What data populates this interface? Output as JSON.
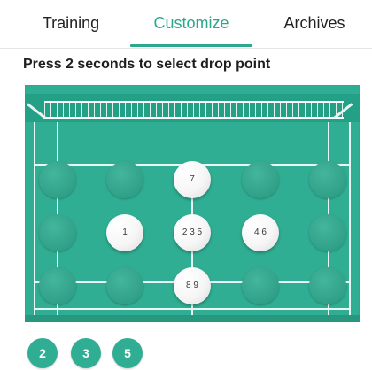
{
  "tabs": [
    {
      "label": "Training",
      "active": false
    },
    {
      "label": "Customize",
      "active": true
    },
    {
      "label": "Archives",
      "active": false
    }
  ],
  "instruction": "Press 2 seconds to select drop point",
  "court": {
    "colors": {
      "court": "#2fae93",
      "accent": "#2ca88f",
      "selected": "#ffffff"
    },
    "drop_points": [
      {
        "row": 1,
        "col": 1,
        "selected": false,
        "labels": ""
      },
      {
        "row": 1,
        "col": 2,
        "selected": false,
        "labels": ""
      },
      {
        "row": 1,
        "col": 3,
        "selected": true,
        "labels": "7"
      },
      {
        "row": 1,
        "col": 4,
        "selected": false,
        "labels": ""
      },
      {
        "row": 1,
        "col": 5,
        "selected": false,
        "labels": ""
      },
      {
        "row": 2,
        "col": 1,
        "selected": false,
        "labels": ""
      },
      {
        "row": 2,
        "col": 2,
        "selected": true,
        "labels": "1"
      },
      {
        "row": 2,
        "col": 3,
        "selected": true,
        "labels": "2 3 5"
      },
      {
        "row": 2,
        "col": 4,
        "selected": true,
        "labels": "4 6"
      },
      {
        "row": 2,
        "col": 5,
        "selected": false,
        "labels": ""
      },
      {
        "row": 3,
        "col": 1,
        "selected": false,
        "labels": ""
      },
      {
        "row": 3,
        "col": 2,
        "selected": false,
        "labels": ""
      },
      {
        "row": 3,
        "col": 3,
        "selected": true,
        "labels": "8 9"
      },
      {
        "row": 3,
        "col": 4,
        "selected": false,
        "labels": ""
      },
      {
        "row": 3,
        "col": 5,
        "selected": false,
        "labels": ""
      }
    ]
  },
  "sequence_chips": [
    "2",
    "3",
    "5"
  ]
}
